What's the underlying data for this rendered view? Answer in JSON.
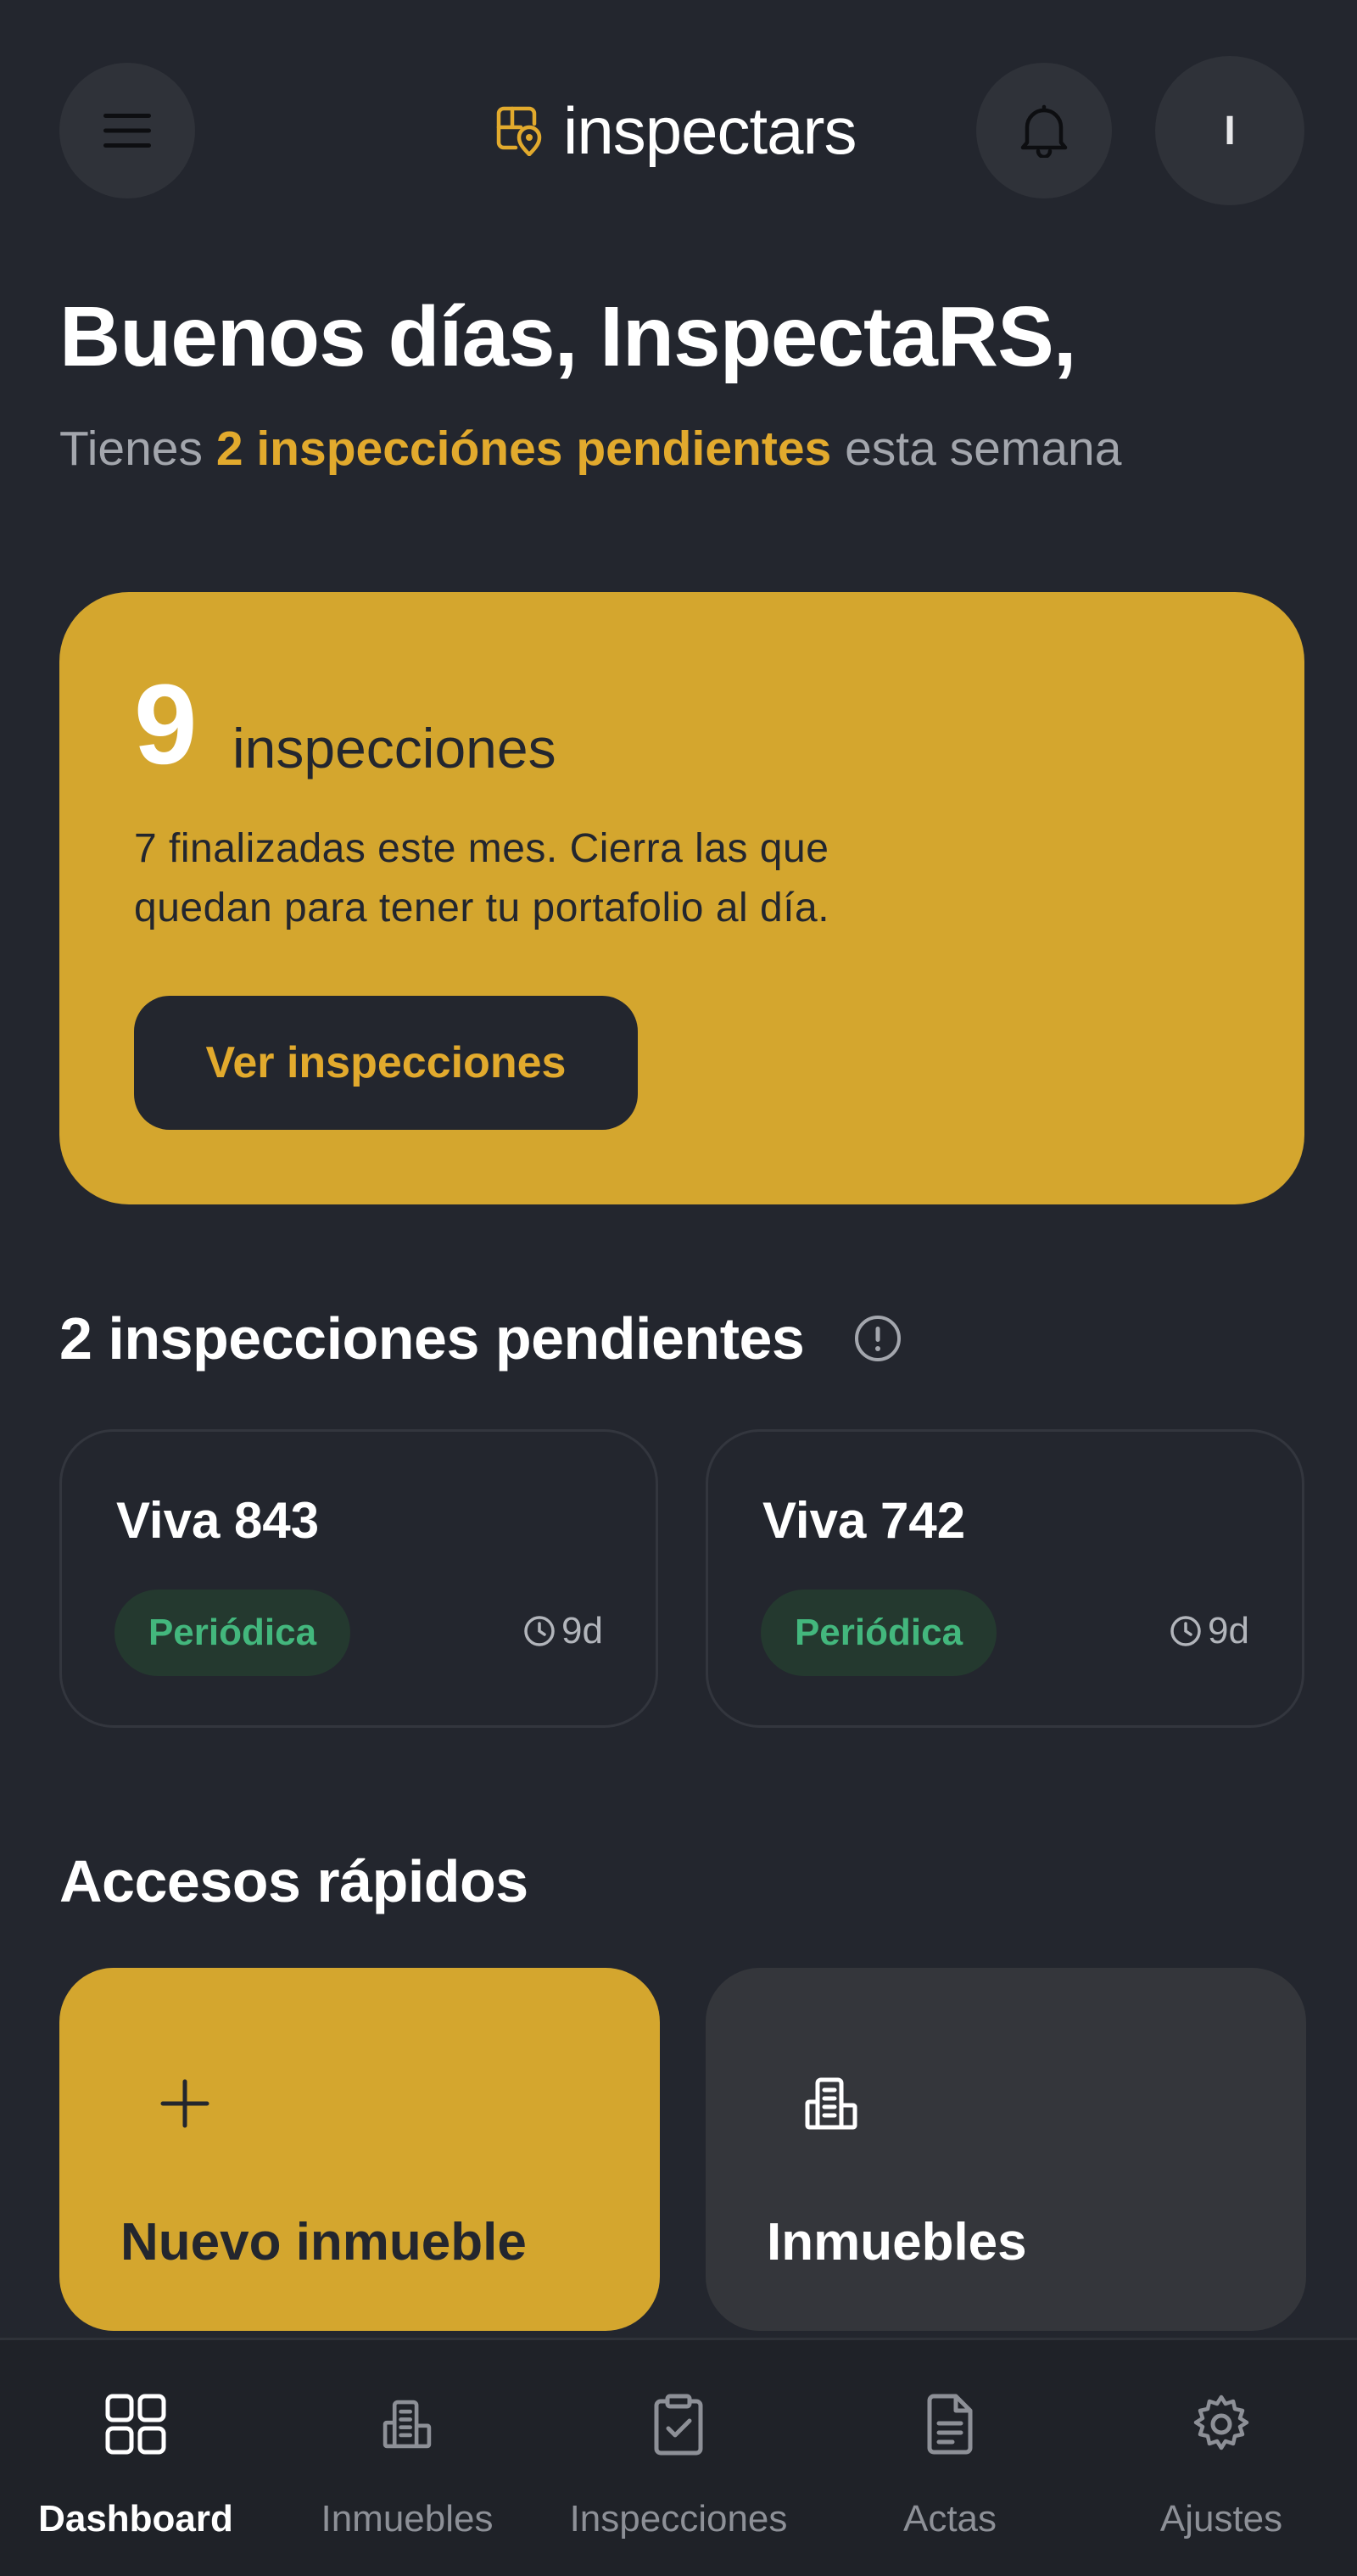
{
  "app": {
    "brand": "inspectars",
    "avatar_initial": "I"
  },
  "greeting": {
    "title": "Buenos días, InspectaRS,",
    "subtitle_prefix": "Tienes ",
    "subtitle_highlight": "2 inspecciónes pendientes",
    "subtitle_suffix": " esta semana"
  },
  "hero": {
    "count": "9",
    "unit": "inspecciones",
    "line1": "7 finalizadas este mes. Cierra las que",
    "line2": "quedan para tener tu portafolio al día.",
    "button_label": "Ver inspecciones"
  },
  "pending": {
    "title": "2 inspecciones pendientes",
    "cards": [
      {
        "title": "Viva 843",
        "badge": "Periódica",
        "time": "9d"
      },
      {
        "title": "Viva 742",
        "badge": "Periódica",
        "time": "9d"
      }
    ]
  },
  "quick_access": {
    "title": "Accesos rápidos",
    "items": [
      {
        "label": "Nuevo inmueble",
        "icon": "plus-icon"
      },
      {
        "label": "Inmuebles",
        "icon": "building-icon"
      }
    ]
  },
  "nav": {
    "items": [
      {
        "label": "Dashboard",
        "icon": "grid-icon",
        "active": true
      },
      {
        "label": "Inmuebles",
        "icon": "building-icon",
        "active": false
      },
      {
        "label": "Inspecciones",
        "icon": "clipboard-check-icon",
        "active": false
      },
      {
        "label": "Actas",
        "icon": "document-icon",
        "active": false
      },
      {
        "label": "Ajustes",
        "icon": "gear-icon",
        "active": false
      }
    ]
  },
  "colors": {
    "background": "#23262e",
    "accent": "#d4a62e",
    "accent_text": "#e2aa2d",
    "success": "#43b77d"
  }
}
